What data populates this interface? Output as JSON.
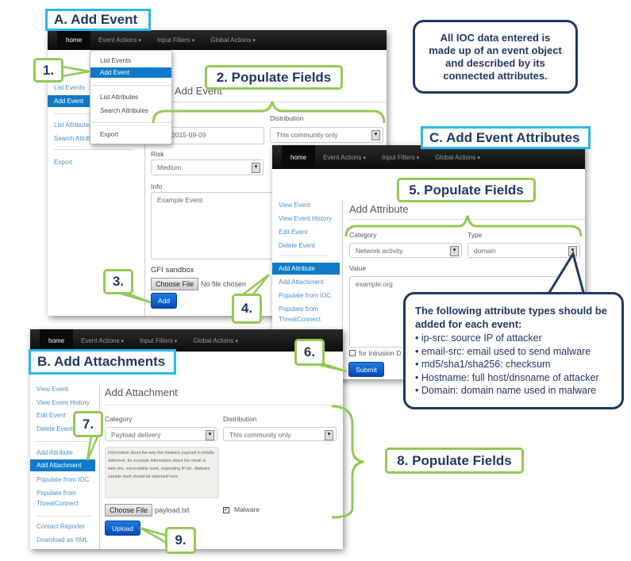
{
  "labels": {
    "a": "A.  Add Event",
    "b": "B.  Add Attachments",
    "c": "C.  Add Event Attributes"
  },
  "steps": [
    "1.",
    "2. Populate Fields",
    "3.",
    "4.",
    "5. Populate Fields",
    "6.",
    "7.",
    "8. Populate Fields",
    "9."
  ],
  "note": "All IOC data entered is made up of an event object and described by its connected attributes.",
  "nav": {
    "home": "home",
    "items": [
      "Event Actions",
      "Input Filters",
      "Global Actions"
    ]
  },
  "panel_a": {
    "sidebar": [
      "List Events",
      "Add Event",
      "List Attributes",
      "Search Attributes",
      "Export"
    ],
    "dropdown": [
      "List Events",
      "Add Event",
      "List Attributes",
      "Search Attributes",
      "Export"
    ],
    "title": "Add Event",
    "date": "2015-09-09",
    "distribution_label": "Distribution",
    "distribution": "This community only",
    "risk_label": "Risk",
    "risk": "Medium",
    "info_label": "Info",
    "info": "Example Event",
    "gfi_label": "GFI sandbox",
    "choose_file": "Choose File",
    "no_file": "No file chosen",
    "add": "Add"
  },
  "panel_c": {
    "sidebar": [
      "View Event",
      "View Event History",
      "Edit Event",
      "Delete Event",
      "Add Attribute",
      "Add Attachment",
      "Populate from IOC",
      "Populate from",
      "ThreatConnect"
    ],
    "title": "Add Attribute",
    "category_label": "Category",
    "category": "Network activity",
    "type_label": "Type",
    "type": "domain",
    "value_label": "Value",
    "value": "example.org",
    "ids_label": "for Intrusion D",
    "submit": "Submit"
  },
  "panel_b": {
    "sidebar": [
      "View Event",
      "View Event History",
      "Edit Event",
      "Delete Event",
      "Add Attribute",
      "Add Attachment",
      "Populate from IOC",
      "Populate from",
      "ThreatConnect",
      "Contact Reporter",
      "Download as XML"
    ],
    "title": "Add Attachment",
    "category_label": "Category",
    "category": "Payload delivery",
    "distribution_label": "Distribution",
    "distribution": "This community only",
    "help": "Information about the way the malware payload is initially delivered, for example information about the email or web-site, vulnerability used, originating IP etc. Malware sample itself should be attached here.",
    "choose_file": "Choose File",
    "file": "payload.txt",
    "malware": "Malware",
    "upload": "Upload"
  },
  "bubble": {
    "heading": "The following attribute types should be added for each event:",
    "items": [
      "ip-src: source IP of attacker",
      "email-src: email used to send malware",
      "md5/sha1/sha256: checksum",
      "Hostname: full host/dnsname of attacker",
      "Domain: domain name used in malware"
    ]
  },
  "colors": {
    "cyan": "#2eb7e8",
    "green": "#93c954",
    "navy": "#1f3864",
    "link": "#4a90c8",
    "active": "#0f7ac9"
  }
}
